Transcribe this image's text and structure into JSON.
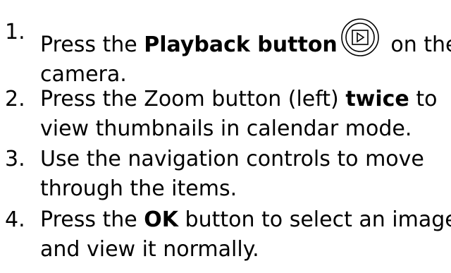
{
  "steps": [
    {
      "number": "1.",
      "line1_pre": "Press the ",
      "line1_bold": "Playback button",
      "playback_icon": "playback-button-icon",
      "line1_post": " on the",
      "line2": "camera."
    },
    {
      "number": "2.",
      "line1_pre": "Press the Zoom button (left) ",
      "line1_bold": "twice",
      "line1_post": " to",
      "line2": "view thumbnails in calendar mode."
    },
    {
      "number": "3.",
      "line1": "Use the navigation controls to move",
      "line2": "through the items."
    },
    {
      "number": "4.",
      "line1_pre": "Press the ",
      "line1_bold": "OK",
      "line1_post": " button to select an image",
      "line2": "and view it normally."
    }
  ]
}
